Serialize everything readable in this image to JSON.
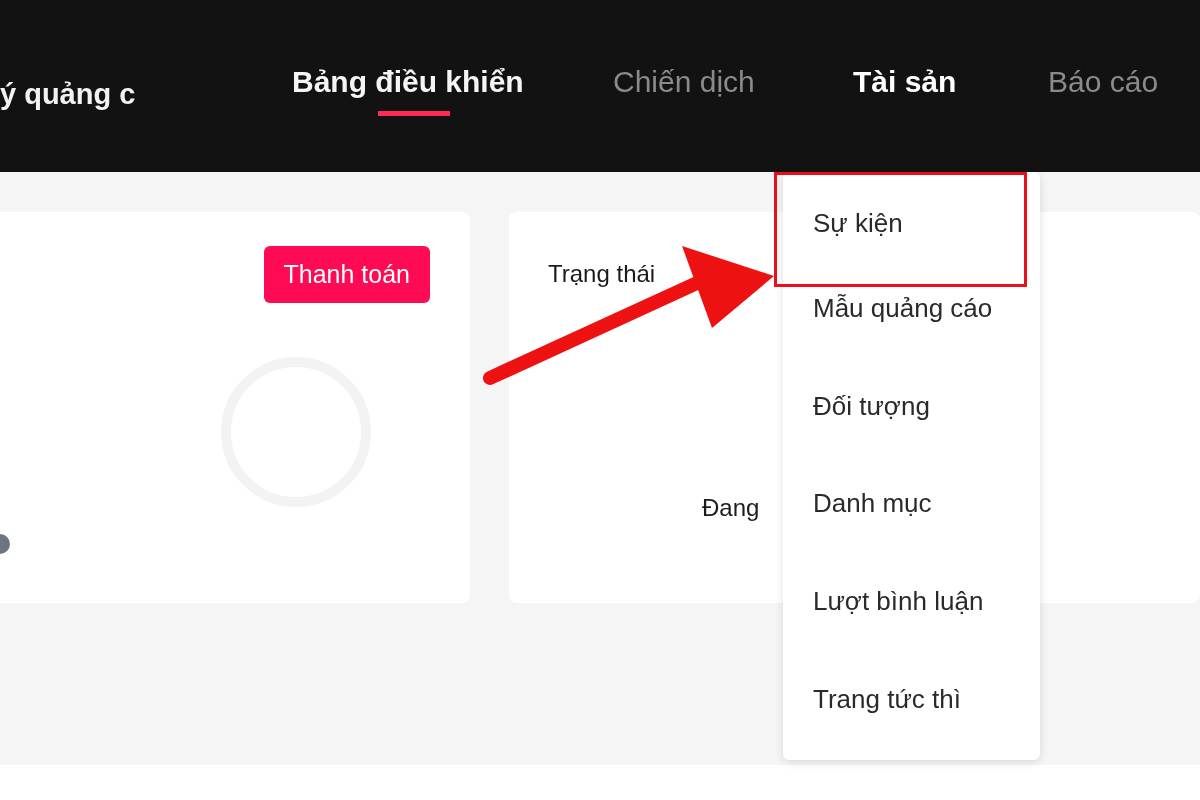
{
  "header": {
    "brand_title": "ý quảng c",
    "nav": [
      {
        "label": "Bảng điều khiển",
        "selected": true,
        "expanded": false
      },
      {
        "label": "Chiến dịch",
        "selected": false,
        "expanded": false
      },
      {
        "label": "Tài sản",
        "selected": false,
        "expanded": true
      },
      {
        "label": "Báo cáo",
        "selected": false,
        "expanded": false
      }
    ]
  },
  "billing_card": {
    "button": "Thanh toán"
  },
  "status_card": {
    "title": "Trạng thái",
    "status": "Đang"
  },
  "dropdown": {
    "items": [
      {
        "label": "Sự kiện",
        "highlighted": true
      },
      {
        "label": "Mẫu quảng cáo",
        "highlighted": false
      },
      {
        "label": "Đối tượng",
        "highlighted": false
      },
      {
        "label": "Danh mục",
        "highlighted": false
      },
      {
        "label": "Lượt bình luận",
        "highlighted": false
      },
      {
        "label": "Trang tức thì",
        "highlighted": false
      }
    ]
  }
}
